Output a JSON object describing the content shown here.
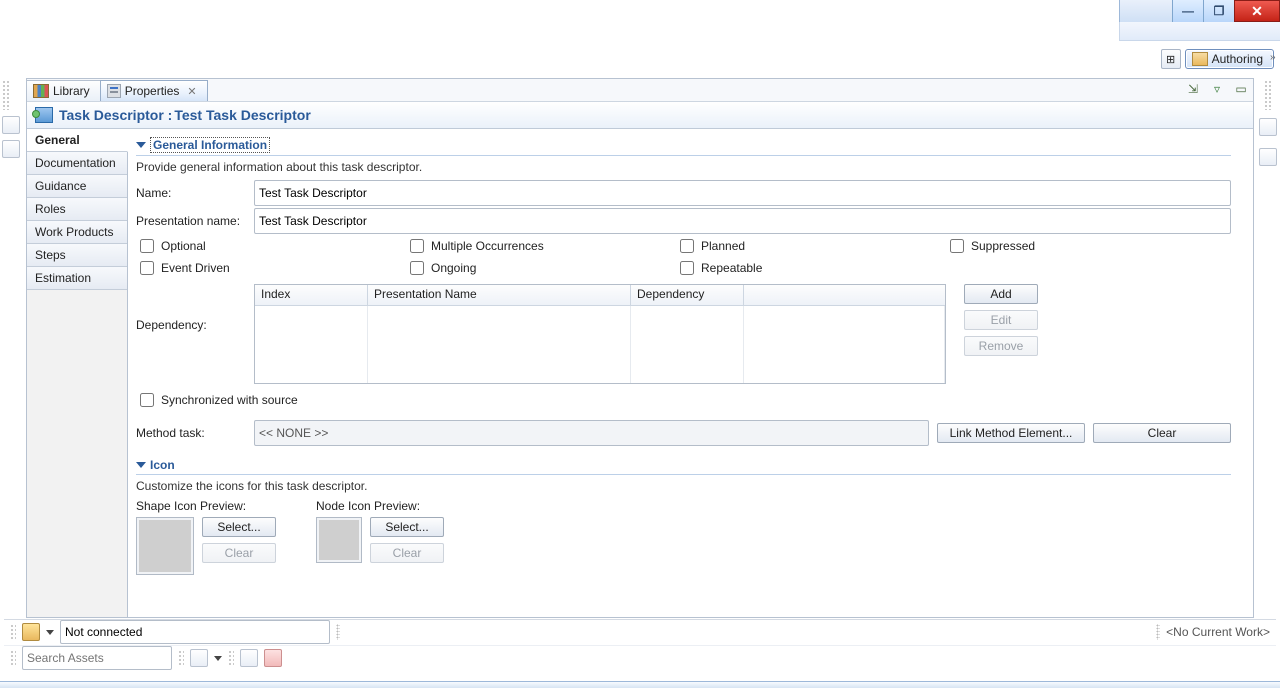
{
  "window": {
    "minimize_tip": "Minimize",
    "restore_tip": "Restore",
    "close_tip": "Close"
  },
  "perspective": {
    "authoring_label": "Authoring"
  },
  "tabs": {
    "library": "Library",
    "properties": "Properties"
  },
  "header": {
    "prefix": "Task Descriptor : ",
    "name": "Test Task Descriptor"
  },
  "side_tabs": [
    "General",
    "Documentation",
    "Guidance",
    "Roles",
    "Work Products",
    "Steps",
    "Estimation"
  ],
  "general": {
    "section_title": "General Information",
    "section_desc": "Provide general information about this task descriptor.",
    "labels": {
      "name": "Name:",
      "presentation": "Presentation name:",
      "dependency": "Dependency:",
      "method_task": "Method task:"
    },
    "name_value": "Test Task Descriptor",
    "presentation_value": "Test Task Descriptor",
    "checkboxes": {
      "optional": "Optional",
      "multiple": "Multiple Occurrences",
      "planned": "Planned",
      "suppressed": "Suppressed",
      "event_driven": "Event Driven",
      "ongoing": "Ongoing",
      "repeatable": "Repeatable"
    },
    "dep_table_headers": {
      "index": "Index",
      "presentation": "Presentation Name",
      "dependency": "Dependency"
    },
    "buttons": {
      "add": "Add",
      "edit": "Edit",
      "remove": "Remove",
      "link": "Link Method Element...",
      "clear": "Clear"
    },
    "sync_label": "Synchronized with source",
    "method_task_value": "<< NONE >>"
  },
  "icon_section": {
    "title": "Icon",
    "desc": "Customize the icons for this task descriptor.",
    "shape_label": "Shape Icon Preview:",
    "node_label": "Node Icon Preview:",
    "select": "Select...",
    "clear": "Clear"
  },
  "status": {
    "not_connected": "Not connected",
    "no_current_work": "<No Current Work>",
    "search_placeholder": "Search Assets"
  }
}
